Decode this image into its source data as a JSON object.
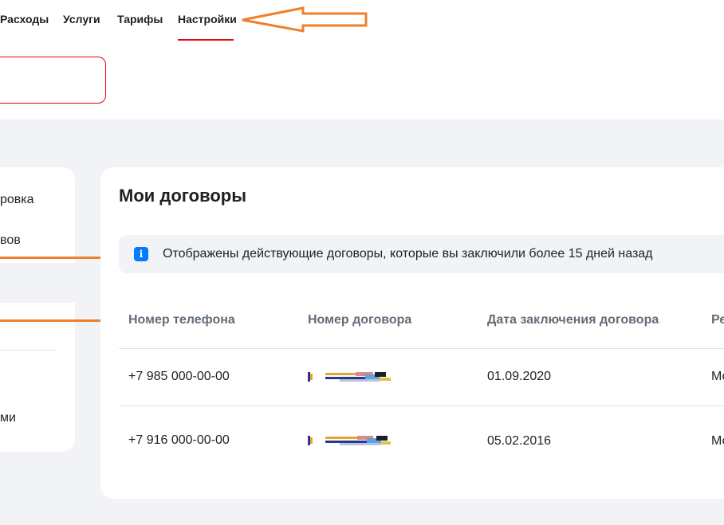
{
  "nav": {
    "items": [
      {
        "label": "Расходы"
      },
      {
        "label": "Услуги"
      },
      {
        "label": "Тарифы"
      },
      {
        "label": "Настройки",
        "active": true
      }
    ]
  },
  "sidebar": {
    "items": [
      {
        "label": "ровка"
      },
      {
        "label": "вов"
      },
      {
        "label": "ми"
      }
    ]
  },
  "main": {
    "title": "Мои договоры",
    "info": "Отображены действующие договоры, которые вы заключили более 15 дней назад",
    "table": {
      "headers": [
        "Номер телефона",
        "Номер договора",
        "Дата заключения договора",
        "Ре"
      ],
      "rows": [
        {
          "phone": "+7 985 000-00-00",
          "date": "01.09.2020",
          "region": "Мо"
        },
        {
          "phone": "+7 916 000-00-00",
          "date": "05.02.2016",
          "region": "Мо"
        }
      ]
    }
  },
  "icons": {
    "info": "info-icon"
  },
  "colors": {
    "accent": "#e30611",
    "info_icon": "#007cff",
    "annotation": "#f07f2a",
    "background": "#f2f3f7",
    "header_text": "#626c77"
  }
}
